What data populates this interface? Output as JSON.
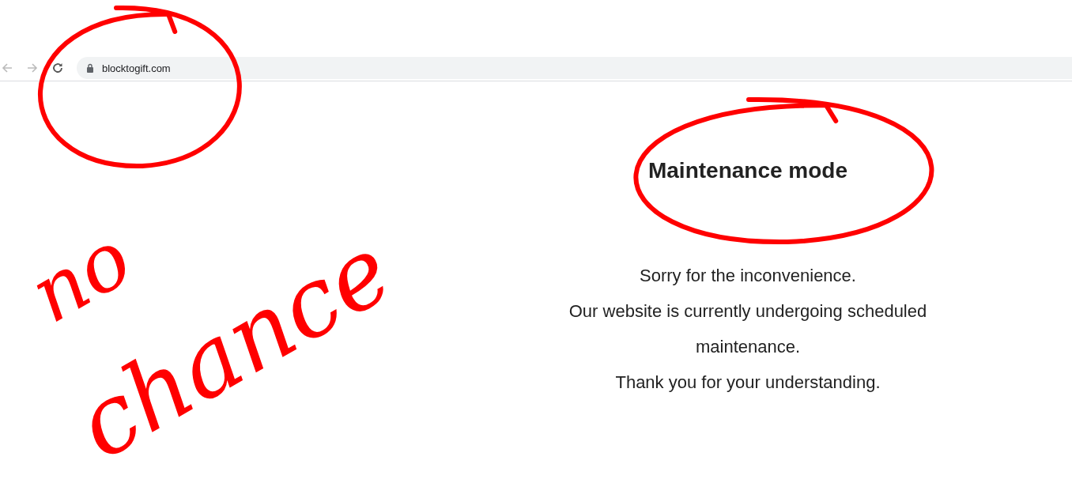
{
  "browser": {
    "back_disabled": true,
    "forward_disabled": true,
    "url": "blocktogift.com",
    "secure": true
  },
  "page": {
    "heading": "Maintenance mode",
    "paragraphs": [
      "Sorry for the inconvenience.",
      "Our website is currently undergoing scheduled maintenance.",
      "Thank you for your understanding."
    ]
  },
  "annotations": [
    {
      "kind": "circle"
    },
    {
      "kind": "circle"
    },
    {
      "kind": "handwriting",
      "text": "no"
    },
    {
      "kind": "handwriting",
      "text": "chance"
    }
  ]
}
